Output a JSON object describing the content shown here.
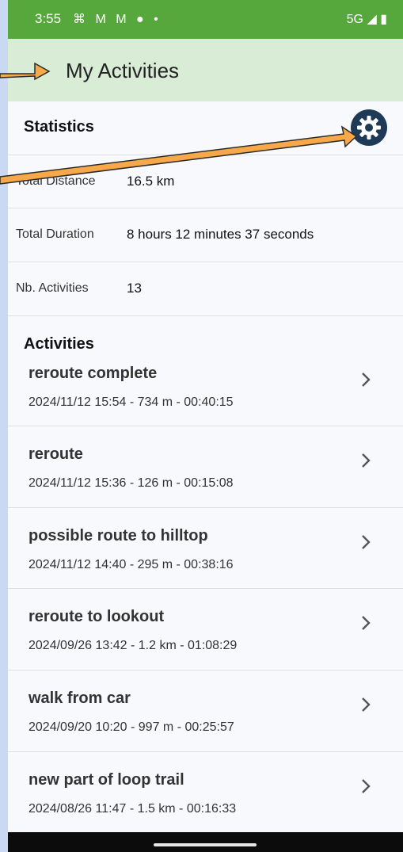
{
  "status_bar": {
    "time": "3:55",
    "notification_icons": "⌘ M M ● •",
    "network": "5G ◢ ▮"
  },
  "app_bar": {
    "title": "My Activities"
  },
  "statistics": {
    "heading": "Statistics",
    "rows": [
      {
        "label": "Total Distance",
        "value": "16.5 km"
      },
      {
        "label": "Total Duration",
        "value": "8 hours 12 minutes 37 seconds"
      },
      {
        "label": "Nb. Activities",
        "value": "13"
      }
    ]
  },
  "activities": {
    "heading": "Activities",
    "items": [
      {
        "name": "reroute complete",
        "meta": "2024/11/12 15:54 - 734 m - 00:40:15"
      },
      {
        "name": "reroute",
        "meta": "2024/11/12 15:36 - 126 m - 00:15:08"
      },
      {
        "name": "possible route to hilltop",
        "meta": "2024/11/12 14:40 - 295 m - 00:38:16"
      },
      {
        "name": "reroute to lookout",
        "meta": "2024/09/26 13:42 - 1.2 km - 01:08:29"
      },
      {
        "name": "walk from car",
        "meta": "2024/09/20 10:20 - 997 m - 00:25:57"
      },
      {
        "name": "new part of loop trail",
        "meta": "2024/08/26 11:47 - 1.5 km - 00:16:33"
      }
    ]
  },
  "colors": {
    "status_bar": "#57a83c",
    "app_bar": "#d8ecd6",
    "settings_button": "#1e3a57",
    "annotation_arrow": "#f7a94a"
  },
  "icons": {
    "settings": "gear-icon",
    "row_chevron": "chevron-right-icon",
    "annotations": "arrow-annotation-icon"
  }
}
